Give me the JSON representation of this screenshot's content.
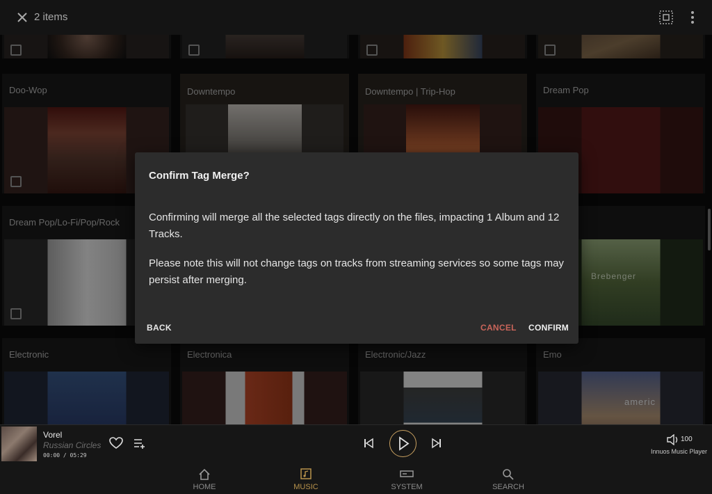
{
  "topbar": {
    "count_label": "2 items",
    "close_icon": "close-icon",
    "select_all_icon": "select-all-icon",
    "menu_icon": "more-vertical-icon"
  },
  "grid": {
    "rows": [
      {
        "tiles": [
          {
            "title": ""
          },
          {
            "title": ""
          },
          {
            "title": ""
          },
          {
            "title": ""
          }
        ]
      },
      {
        "tiles": [
          {
            "title": "Doo-Wop"
          },
          {
            "title": "Downtempo"
          },
          {
            "title": "Downtempo | Trip-Hop"
          },
          {
            "title": "Dream Pop"
          }
        ]
      },
      {
        "tiles": [
          {
            "title": "Dream Pop/Lo-Fi/Pop/Rock"
          },
          {
            "title": ""
          },
          {
            "title": ""
          },
          {
            "title": ""
          }
        ]
      },
      {
        "tiles": [
          {
            "title": "Electronic"
          },
          {
            "title": "Electronica"
          },
          {
            "title": "Electronic/Jazz"
          },
          {
            "title": "Emo"
          }
        ]
      }
    ],
    "art_text": {
      "brebenger": "Brebenger",
      "americ": "americ"
    }
  },
  "dialog": {
    "title": "Confirm Tag Merge?",
    "paragraph1": "Confirming will merge all the selected tags directly on the files, impacting 1 Album and 12 Tracks.",
    "paragraph2": "Please note this will not change tags on tracks from streaming services so some tags may persist after merging.",
    "back_label": "BACK",
    "cancel_label": "CANCEL",
    "confirm_label": "CONFIRM",
    "cancel_color": "#c9655a"
  },
  "player": {
    "track": "Vorel",
    "artist": "Russian Circles",
    "time": "00:00 / 05:29",
    "volume": "100",
    "device": "Innuos Music Player",
    "accent": "#c8a060"
  },
  "nav": {
    "items": [
      {
        "label": "HOME",
        "icon": "home-icon"
      },
      {
        "label": "MUSIC",
        "icon": "music-icon",
        "active": true
      },
      {
        "label": "SYSTEM",
        "icon": "system-icon"
      },
      {
        "label": "SEARCH",
        "icon": "search-icon"
      }
    ]
  }
}
